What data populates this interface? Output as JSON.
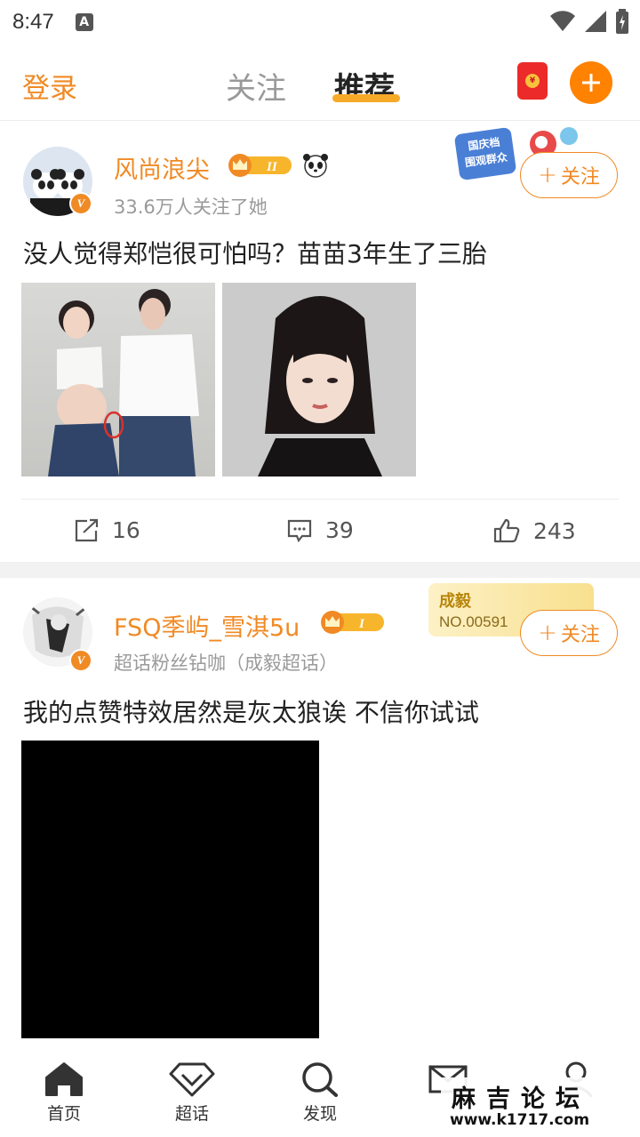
{
  "status_bar": {
    "time": "8:47",
    "notification_letter": "A"
  },
  "top_nav": {
    "login": "登录",
    "tabs": [
      {
        "label": "关注",
        "active": false
      },
      {
        "label": "推荐",
        "active": true
      }
    ],
    "icons": [
      "red-packet-icon",
      "add-icon"
    ]
  },
  "posts": [
    {
      "username": "风尚浪尖",
      "level_badge": "II",
      "subline": "33.6万人关注了她",
      "follow_label": "关注",
      "decoration_text": [
        "国庆档",
        "围观群众"
      ],
      "text": "没人觉得郑恺很可怕吗？苗苗3年生了三胎",
      "actions": {
        "repost": "16",
        "comment": "39",
        "like": "243"
      }
    },
    {
      "username": "FSQ季屿_雪淇5u",
      "level_badge": "I",
      "subline": "超话粉丝钻咖（成毅超话）",
      "follow_label": "关注",
      "fan_card": {
        "name": "成毅",
        "number": "NO.00591"
      },
      "text": "我的点赞特效居然是灰太狼诶 不信你试试"
    }
  ],
  "bottom_nav": [
    {
      "label": "首页",
      "icon": "home-icon"
    },
    {
      "label": "超话",
      "icon": "diamond-icon"
    },
    {
      "label": "发现",
      "icon": "search-icon"
    },
    {
      "label": "",
      "icon": "mail-icon"
    },
    {
      "label": "",
      "icon": "profile-icon"
    }
  ],
  "watermark": {
    "title": "麻吉论坛",
    "url": "www.k1717.com"
  },
  "colors": {
    "accent": "#f08a24",
    "tab_underline": "#f7a928",
    "plus_button": "#ff8200",
    "red_packet": "#ec2a2a"
  }
}
